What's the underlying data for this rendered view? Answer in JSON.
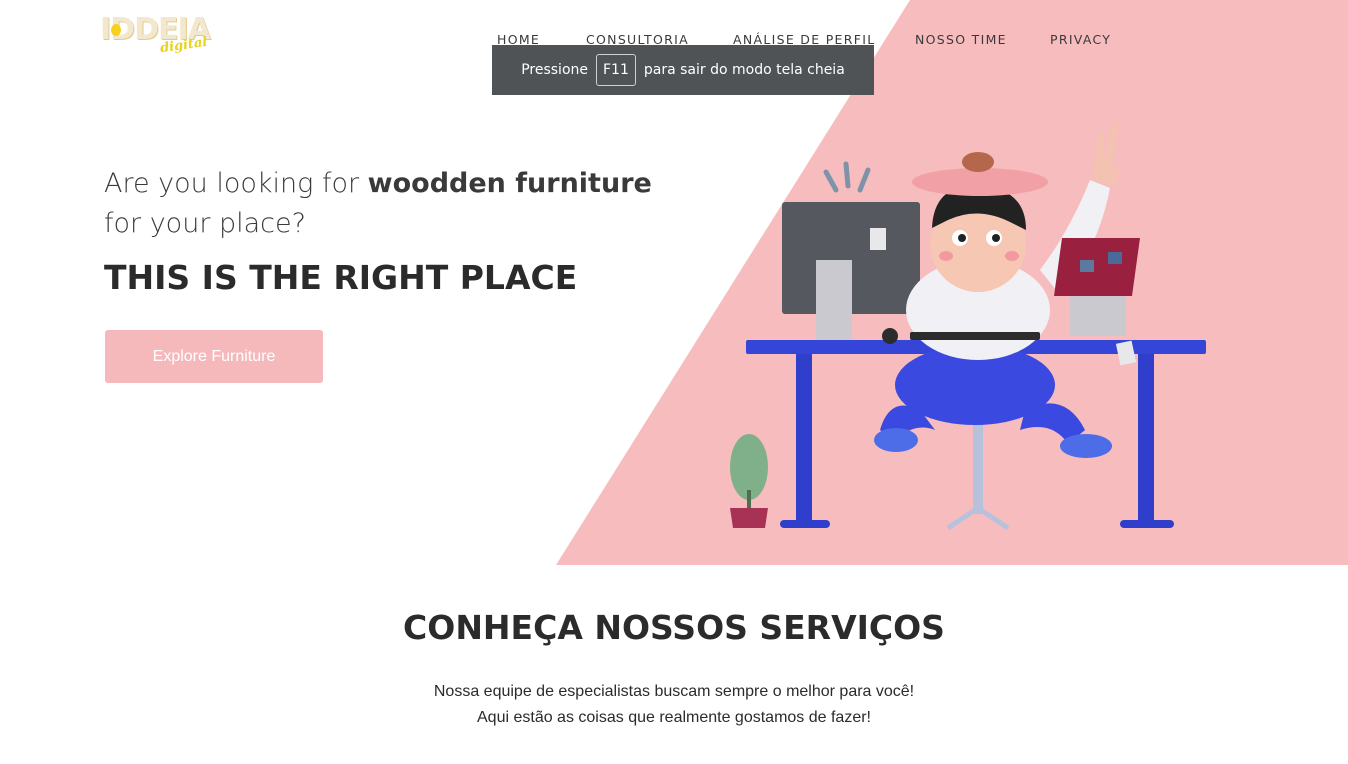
{
  "brand": {
    "logo_main": "IDDEIA",
    "logo_sub": "digital"
  },
  "nav": {
    "items": [
      {
        "label": "HOME"
      },
      {
        "label": "CONSULTORIA"
      },
      {
        "label": "ANÁLISE DE PERFIL"
      },
      {
        "label": "NOSSO TIME"
      },
      {
        "label": "PRIVACY"
      }
    ]
  },
  "fullscreen_toast": {
    "before": "Pressione",
    "key": "F11",
    "after": "para sair do modo tela cheia"
  },
  "hero": {
    "question_start": "Are you looking for",
    "question_bold": "woodden furniture",
    "question_end": "for your place?",
    "title": "THIS IS THE RIGHT PLACE",
    "cta_label": "Explore Furniture"
  },
  "services": {
    "title": "CONHEÇA NOSSOS SERVIÇOS",
    "line1": "Nossa equipe de especialistas buscam sempre o melhor para você!",
    "line2": "Aqui estão as coisas que realmente gostamos de fazer!"
  },
  "colors": {
    "accent_pink": "#f6b9bb",
    "desk_blue": "#3040d8",
    "text_dark": "#2b2b2b"
  }
}
